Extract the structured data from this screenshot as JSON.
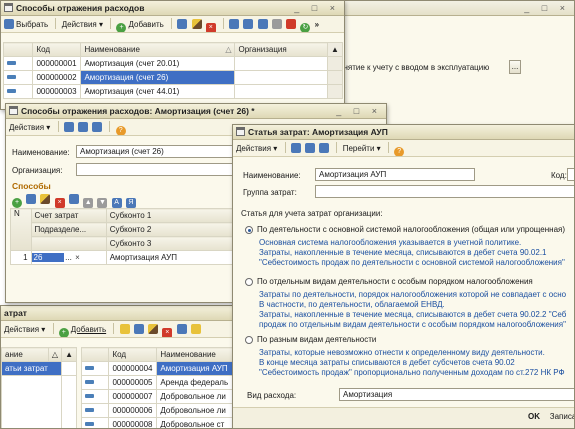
{
  "win1": {
    "title": "Способы отражения расходов",
    "toolbar": {
      "select": "Выбрать",
      "actions": "Действия",
      "add": "Добавить"
    },
    "columns": [
      "Код",
      "Наименование",
      "Организация"
    ],
    "rows": [
      {
        "code": "000000001",
        "name": "Амортизация (счет 20.01)"
      },
      {
        "code": "000000002",
        "name": "Амортизация (счет 26)"
      },
      {
        "code": "000000003",
        "name": "Амортизация (счет 44.01)"
      }
    ]
  },
  "bgwin": {
    "line": "инятие к учету с вводом в эксплуатацию",
    "btn": "..."
  },
  "win2": {
    "title": "Способы отражения расходов: Амортизация (счет 26) *",
    "toolbar": {
      "actions": "Действия"
    },
    "name_label": "Наименование:",
    "name_value": "Амортизация (счет 26)",
    "org_label": "Организация:",
    "section": "Способы",
    "table": {
      "h_n": "N",
      "h_account": "Счет затрат",
      "h_sub1": "Субконто 1",
      "h_div": "Подразделе...",
      "h_sub2": "Субконто 2",
      "h_sub3": "Субконто 3",
      "row_n": "1",
      "row_account": "26",
      "row_dots": "...",
      "row_x": "×",
      "row_sub1": "Амортизация АУП"
    }
  },
  "win3": {
    "title": "атраt",
    "toolbar": {
      "actions": "Действия",
      "add": "Добавить"
    },
    "left_header": "ание",
    "left_selected": "атьи затрат",
    "columns": [
      "Код",
      "Наименование"
    ],
    "rows": [
      {
        "code": "000000004",
        "name": "Амортизация АУП"
      },
      {
        "code": "000000005",
        "name": "Аренда федераль"
      },
      {
        "code": "000000007",
        "name": "Добровольное ли"
      },
      {
        "code": "000000006",
        "name": "Добровольное ли"
      },
      {
        "code": "000000008",
        "name": "Добровольное ст"
      }
    ]
  },
  "win4": {
    "title": "Статья затрат: Амортизация АУП",
    "toolbar": {
      "actions": "Действия",
      "goto": "Перейти"
    },
    "name_label": "Наименование:",
    "name_value": "Амортизация АУП",
    "code_label": "Код:",
    "group_label": "Группа затрат:",
    "article_label": "Статья для учета затрат организации:",
    "opt1": {
      "label": "По деятельности с основной системой налогообложения (общая или упрощенная)",
      "lines": [
        "Основная система налогообложения указывается в учетной политике.",
        "Затраты, накопленные в течение месяца, списываются в дебет счета 90.02.1",
        "\"Себестоимость продаж по деятельности с основной системой налогообложения\""
      ]
    },
    "opt2": {
      "label": "По отдельным видам деятельности с особым порядком налогообложения",
      "lines": [
        "Затраты по деятельности, порядок налогообложения которой не совпадает с осно",
        "В частности, по деятельности, облагаемой ЕНВД.",
        "Затраты, накопленные в течение месяца, списываются в дебет счета 90.02.2 \"Себ",
        "продаж по отдельным видам деятельности с особым порядком налогообложения\""
      ]
    },
    "opt3": {
      "label": "По разным видам деятельности",
      "lines": [
        "Затраты, которые невозможно отнести к определенному виду деятельности.",
        "В конце месяца затраты списываются в дебет субсчетов счета 90.02",
        "\"Себестоимость продаж\" пропорционально полученным доходам по ст.272 НК РФ"
      ]
    },
    "expense_label": "Вид расхода:",
    "expense_value": "Амортизация",
    "ok": "OK",
    "record": "Записа"
  }
}
